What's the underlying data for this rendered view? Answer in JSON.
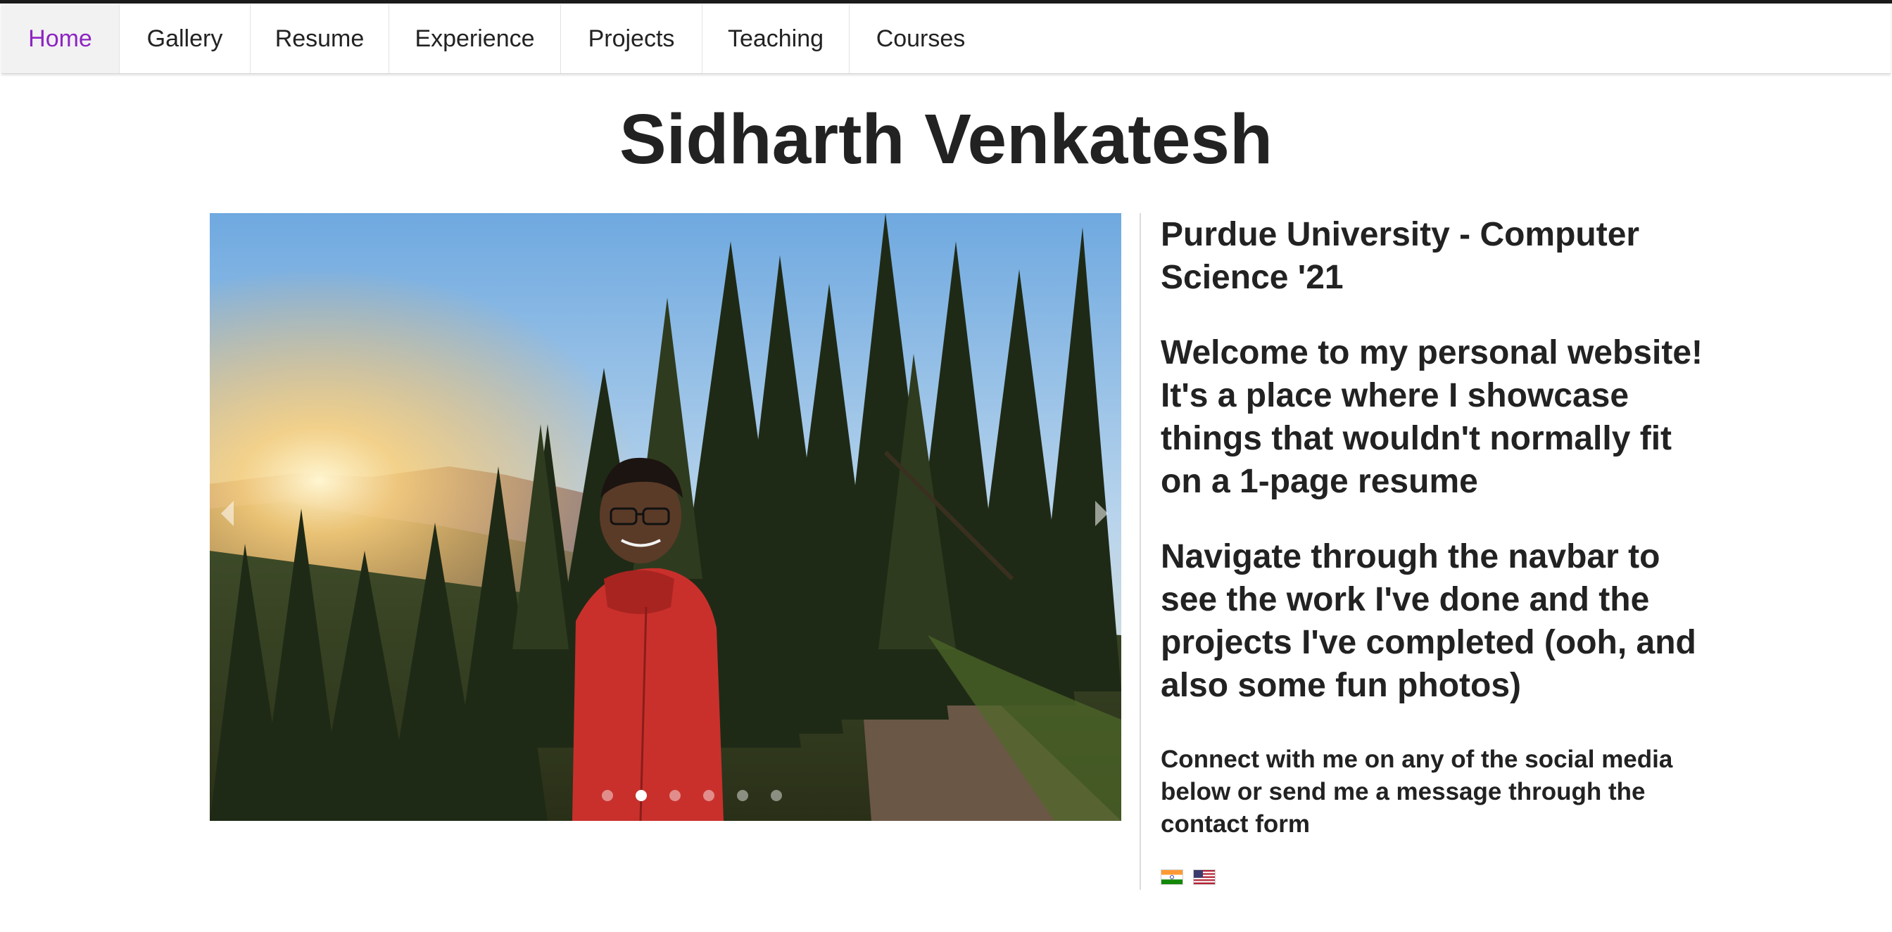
{
  "nav": {
    "items": [
      {
        "label": "Home",
        "active": true
      },
      {
        "label": "Gallery",
        "active": false
      },
      {
        "label": "Resume",
        "active": false
      },
      {
        "label": "Experience",
        "active": false
      },
      {
        "label": "Projects",
        "active": false
      },
      {
        "label": "Teaching",
        "active": false
      },
      {
        "label": "Courses",
        "active": false
      }
    ],
    "active_color": "#8e24c2"
  },
  "page": {
    "title": "Sidharth Venkatesh"
  },
  "carousel": {
    "slide_count": 6,
    "active_slide": 2,
    "prev_icon": "chevron-left-icon",
    "next_icon": "chevron-right-icon"
  },
  "info": {
    "school": "Purdue University - Computer Science '21",
    "welcome": "Welcome to my personal website! It's a place where I showcase things that wouldn't normally fit on a 1-page resume",
    "navigate": "Navigate through the navbar to see the work I've done and the projects I've completed (ooh, and also some fun photos)",
    "connect": "Connect with me on any of the social media below or send me a message through the contact form"
  },
  "flags": [
    {
      "name": "india-flag-icon"
    },
    {
      "name": "usa-flag-icon"
    }
  ]
}
